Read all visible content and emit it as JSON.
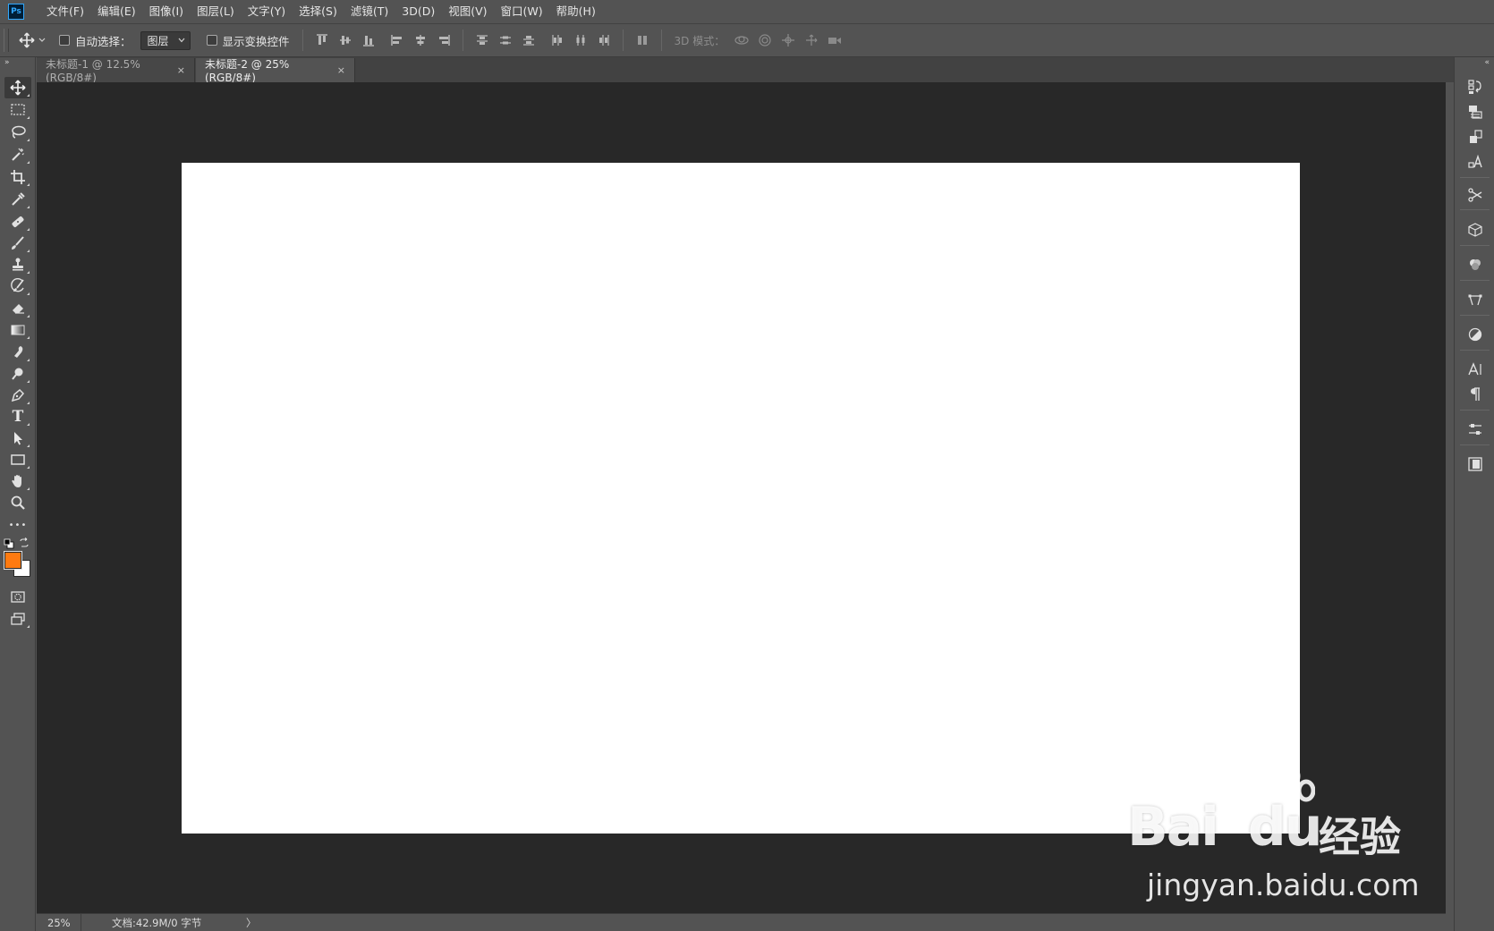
{
  "app": {
    "logo_text": "Ps"
  },
  "menu": {
    "items": [
      "文件(F)",
      "编辑(E)",
      "图像(I)",
      "图层(L)",
      "文字(Y)",
      "选择(S)",
      "滤镜(T)",
      "3D(D)",
      "视图(V)",
      "窗口(W)",
      "帮助(H)"
    ]
  },
  "options": {
    "auto_select_label": "自动选择：",
    "auto_select_value": "图层",
    "show_transform_label": "显示变换控件",
    "mode_3d_label": "3D 模式："
  },
  "tabs": [
    {
      "label": "未标题-1 @ 12.5%(RGB/8#)",
      "close": "×",
      "active": false
    },
    {
      "label": "未标题-2 @ 25%(RGB/8#)",
      "close": "×",
      "active": true
    }
  ],
  "status": {
    "zoom": "25%",
    "doc_info": "文档:42.9M/0 字节",
    "arrow": "〉"
  },
  "colors": {
    "foreground": "#ff7a10",
    "background": "#ffffff",
    "canvas": "#ffffff",
    "workspace": "#282828",
    "chrome": "#535353"
  },
  "watermark": {
    "brand": "Bai",
    "brand_suffix": "du",
    "cn": "经验",
    "url": "jingyan.baidu.com"
  },
  "toolbar": {
    "collapse": "»",
    "tools": [
      "move-tool",
      "marquee-tool",
      "lasso-tool",
      "magic-wand-tool",
      "crop-tool",
      "eyedropper-tool",
      "healing-brush-tool",
      "brush-tool",
      "clone-stamp-tool",
      "history-brush-tool",
      "eraser-tool",
      "gradient-tool",
      "blur-tool",
      "dodge-tool",
      "pen-tool",
      "type-tool",
      "path-selection-tool",
      "rectangle-tool",
      "hand-tool",
      "zoom-tool",
      "more-tools"
    ]
  },
  "type_tool_glyph": "T",
  "more_tools_glyph": "•••",
  "rightdock": {
    "collapse": "«"
  }
}
